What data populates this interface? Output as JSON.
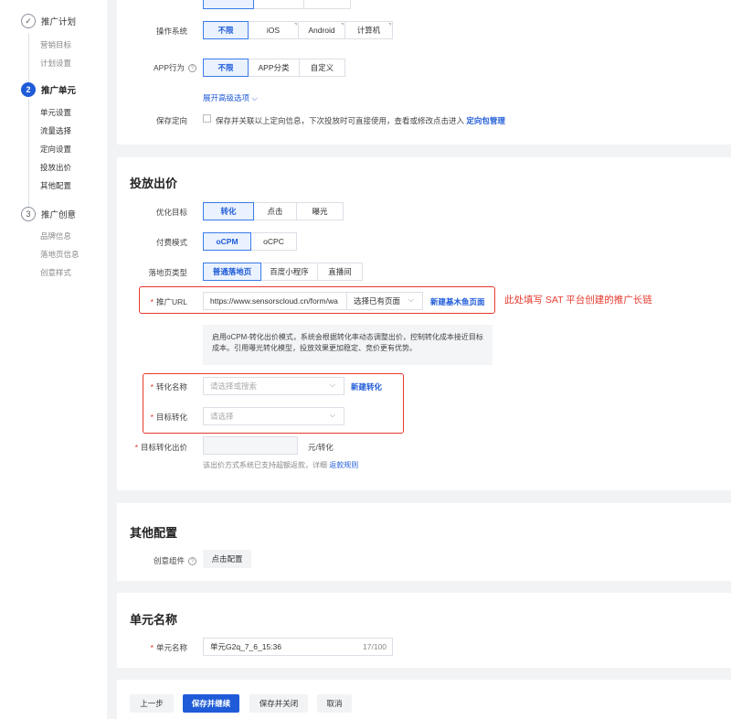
{
  "sidebar": {
    "steps": [
      {
        "label": "推广计划",
        "num": "✓",
        "subs": [
          "营销目标",
          "计划设置"
        ]
      },
      {
        "label": "推广单元",
        "num": "2",
        "subs": [
          "单元设置",
          "流量选择",
          "定向设置",
          "投放出价",
          "其他配置"
        ]
      },
      {
        "label": "推广创意",
        "num": "3",
        "subs": [
          "品牌信息",
          "落地页信息",
          "创意样式"
        ]
      }
    ]
  },
  "targeting": {
    "os_label": "操作系统",
    "os_options": [
      "不限",
      "iOS",
      "Android",
      "计算机"
    ],
    "app_label": "APP行为",
    "app_options": [
      "不限",
      "APP分类",
      "自定义"
    ],
    "expand_label": "展开高级选项",
    "save_label": "保存定向",
    "save_text": "保存并关联以上定向信息，下次投放时可直接使用，查看或修改点击进入",
    "save_link": "定向包管理"
  },
  "bidding": {
    "title": "投放出价",
    "goal_label": "优化目标",
    "goal_options": [
      "转化",
      "点击",
      "曝光"
    ],
    "pay_label": "付费模式",
    "pay_options": [
      "oCPM",
      "oCPC"
    ],
    "landing_label": "落地页类型",
    "landing_options": [
      "普通落地页",
      "百度小程序",
      "直播间"
    ],
    "url_label": "推广URL",
    "url_value": "https://www.sensorscloud.cn/form/wa",
    "url_select": "选择已有页面",
    "url_link": "新建基木鱼页面",
    "annotation": "此处填写 SAT 平台创建的推广长链",
    "info_text": "启用oCPM-转化出价模式，系统会根据转化率动态调整出价，控制转化成本接近目标成本。引用曝光转化模型，投放效果更加稳定、竞价更有优势。",
    "conv_name_label": "转化名称",
    "conv_name_placeholder": "请选择或搜索",
    "conv_new_link": "新建转化",
    "target_conv_label": "目标转化",
    "target_conv_placeholder": "请选择",
    "target_bid_label": "目标转化出价",
    "target_bid_unit": "元/转化",
    "bid_hint": "该出价方式系统已支持超额返款，详细",
    "bid_hint_link": "返款规则"
  },
  "other": {
    "title": "其他配置",
    "creative_label": "创意组件",
    "creative_btn": "点击配置"
  },
  "unit": {
    "title": "单元名称",
    "name_label": "单元名称",
    "name_value": "单元G2q_7_6_15:36",
    "name_count": "17/100"
  },
  "footer": {
    "prev": "上一步",
    "save_continue": "保存并继续",
    "save_close": "保存并关闭",
    "cancel": "取消"
  },
  "colors": {
    "primary": "#1f5bd8",
    "annotation": "#e5392e"
  }
}
